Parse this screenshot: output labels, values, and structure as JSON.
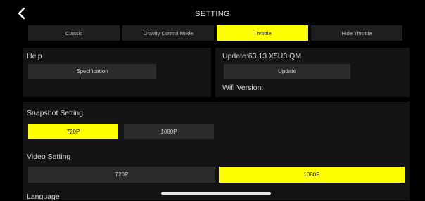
{
  "header": {
    "title": "SETTING",
    "back_icon": "chevron-left-icon"
  },
  "tabs": [
    {
      "label": "Classic",
      "active": false
    },
    {
      "label": "Gravity Control Mode",
      "active": false
    },
    {
      "label": "Throttle",
      "active": true
    },
    {
      "label": "Hide Throttle",
      "active": false
    }
  ],
  "help": {
    "title": "Help",
    "specification_label": "Specification"
  },
  "update": {
    "version_text": "Update:63.13.X5U3.QM",
    "update_label": "Update",
    "wifi_version_label": "Wifi Version:"
  },
  "snapshot": {
    "title": "Snapshot Setting",
    "options": [
      "720P",
      "1080P"
    ],
    "selected": "720P"
  },
  "video": {
    "title": "Video Setting",
    "options": [
      "720P",
      "1080P"
    ],
    "selected": "1080P"
  },
  "language": {
    "title": "Language"
  },
  "colors": {
    "accent": "#ffff00",
    "background": "#000000",
    "panel": "#141414",
    "button": "#2b2b2b"
  }
}
